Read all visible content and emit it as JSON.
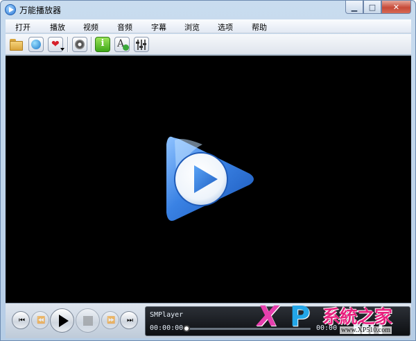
{
  "window": {
    "title": "万能播放器",
    "controls": {
      "minimize": "▁",
      "maximize": "□",
      "close": "✕"
    }
  },
  "menu": {
    "items": [
      "打开",
      "播放",
      "视频",
      "音频",
      "字幕",
      "浏览",
      "选项",
      "帮助"
    ]
  },
  "toolbar": {
    "buttons": [
      "open-folder-icon",
      "globe-icon",
      "favorites-icon",
      "disc-icon",
      "info-icon",
      "font-icon",
      "equalizer-icon"
    ],
    "info_glyph": "i",
    "font_glyph": "A",
    "favorites_glyph": "❤"
  },
  "video": {
    "logo": "play-logo-icon",
    "logo_colors": {
      "outer": "#2a6fd4",
      "inner": "#ffffff",
      "triangle": "#2f7fe0"
    }
  },
  "controls": {
    "prev": "⏮",
    "rewind": "⏪",
    "play": "play-icon",
    "stop": "stop-icon",
    "forward": "⏩",
    "next": "⏭"
  },
  "lcd": {
    "title": "SMPlayer",
    "elapsed": "00:00:00",
    "total": "00:00",
    "progress": 0,
    "glyphs": "██▌▌"
  },
  "watermark": {
    "x": "X",
    "p": "P",
    "text": "系統之家",
    "url": "www.XP510.com",
    "colors": {
      "x": "#e63fae",
      "p": "#23a6e8",
      "text": "#e8217f"
    }
  }
}
